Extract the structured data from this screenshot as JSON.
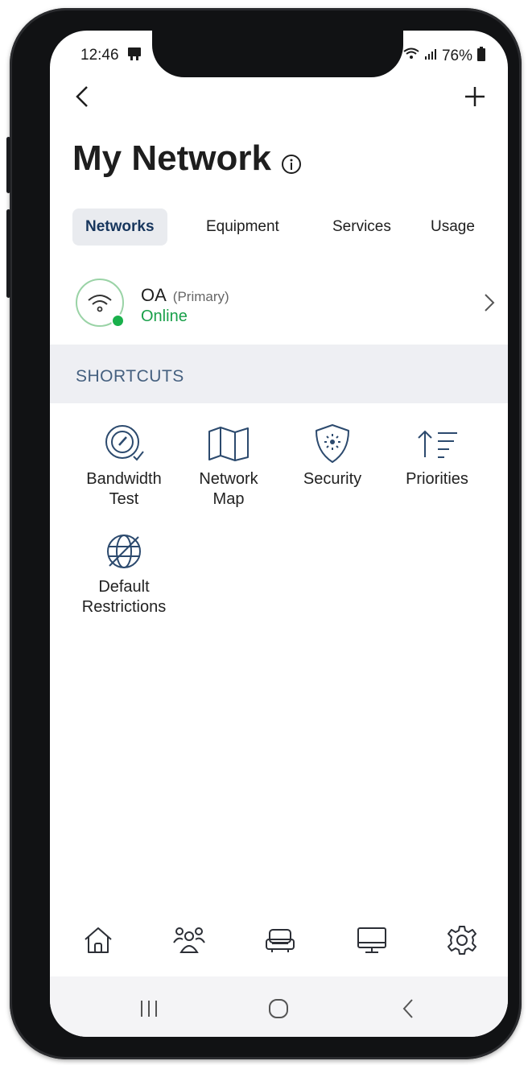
{
  "status_bar": {
    "time": "12:46",
    "battery": "76%",
    "icons": [
      "notification-icon",
      "wifi-status-icon",
      "signal-icon",
      "battery-icon"
    ]
  },
  "header": {
    "back_icon": "back-chevron-icon",
    "add_icon": "plus-icon",
    "title": "My Network",
    "info_icon": "info-icon"
  },
  "tabs": [
    {
      "label": "Networks",
      "active": true
    },
    {
      "label": "Equipment",
      "active": false
    },
    {
      "label": "Services",
      "active": false
    },
    {
      "label": "Usage",
      "active": false
    }
  ],
  "network": {
    "name": "OA",
    "role": "(Primary)",
    "status": "Online",
    "status_color": "#19a04a",
    "icon": "wifi-icon"
  },
  "shortcuts": {
    "header": "SHORTCUTS",
    "items": [
      {
        "line1": "Bandwidth",
        "line2": "Test",
        "icon": "speedometer-icon"
      },
      {
        "line1": "Network",
        "line2": "Map",
        "icon": "map-icon"
      },
      {
        "line1": "Security",
        "line2": "",
        "icon": "shield-icon"
      },
      {
        "line1": "Priorities",
        "line2": "",
        "icon": "priorities-icon"
      },
      {
        "line1": "Default",
        "line2": "Restrictions",
        "icon": "globe-restricted-icon"
      }
    ]
  },
  "bottom_nav": [
    "home-icon",
    "people-icon",
    "sofa-icon",
    "monitor-icon",
    "gear-icon"
  ],
  "system_nav": [
    "recents-icon",
    "home-circle-icon",
    "back-icon"
  ],
  "colors": {
    "accent": "#17365d",
    "online": "#19b04b",
    "section_bg": "#eeeff3",
    "icon": "#2c4a6e"
  }
}
